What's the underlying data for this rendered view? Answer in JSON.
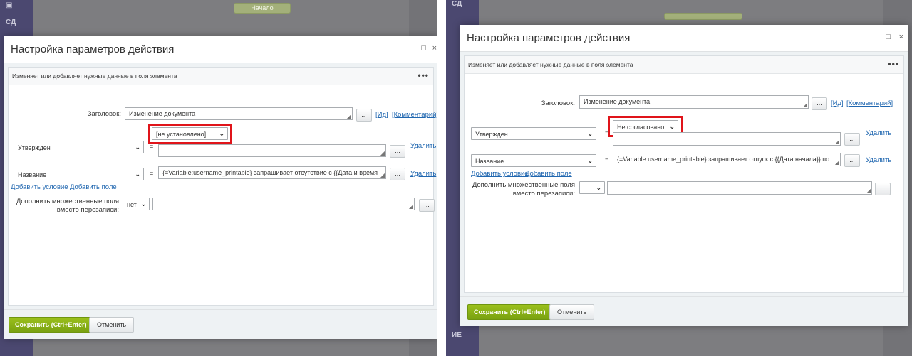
{
  "screenshots": [
    {
      "background": {
        "sidebar_items": [
          "СД"
        ],
        "node_label": "Начало"
      },
      "dialog": {
        "title": "Настройка параметров действия",
        "subtitle": "Изменяет или добавляет нужные данные в поля элемента",
        "header_label": "Заголовок:",
        "header_value": "Изменение документа",
        "header_links": [
          "[Ид]",
          "[Комментарий]"
        ],
        "rows": [
          {
            "field": "Утвержден",
            "status_value": "[не установлено]",
            "value_text": "",
            "delete_label": "Удалить"
          },
          {
            "field": "Название",
            "value_text": "{=Variable:username_printable} запрашивает отсутствие с {{Дата и время",
            "delete_label": "Удалить"
          }
        ],
        "add_condition": "Добавить условие",
        "add_field": "Добавить поле",
        "multi_label_1": "Дополнить множественные поля",
        "multi_label_2": "вместо перезаписи:",
        "multi_value": "нет",
        "save_label": "Сохранить (Ctrl+Enter)",
        "cancel_label": "Отменить"
      }
    },
    {
      "background": {
        "sidebar_items": [
          "СД",
          "ИЕ"
        ]
      },
      "dialog": {
        "title": "Настройка параметров действия",
        "subtitle": "Изменяет или добавляет нужные данные в поля элемента",
        "header_label": "Заголовок:",
        "header_value": "Изменение документа",
        "header_links": [
          "[Ид]",
          "[Комментарий]"
        ],
        "rows": [
          {
            "field": "Утвержден",
            "status_value": "Не согласовано",
            "value_text": "",
            "delete_label": "Удалить"
          },
          {
            "field": "Название",
            "value_text": "{=Variable:username_printable} запрашивает отпуск с {{Дата начала}} по",
            "delete_label": "Удалить"
          }
        ],
        "add_condition": "Добавить условие",
        "add_field": "Добавить поле",
        "multi_label_1": "Дополнить множественные поля",
        "multi_label_2": "вместо перезаписи:",
        "multi_value": "",
        "save_label": "Сохранить (Ctrl+Enter)",
        "cancel_label": "Отменить"
      }
    }
  ],
  "common": {
    "dots": "...",
    "equals": "=",
    "minimize_icon": "□",
    "close_icon": "×",
    "more_icon": "•••",
    "chevron_icon": "⌄",
    "resize_icon": "◢",
    "highlight_color": "#e0141a",
    "accent_green": "#7aa211",
    "link_color": "#2067b0"
  }
}
